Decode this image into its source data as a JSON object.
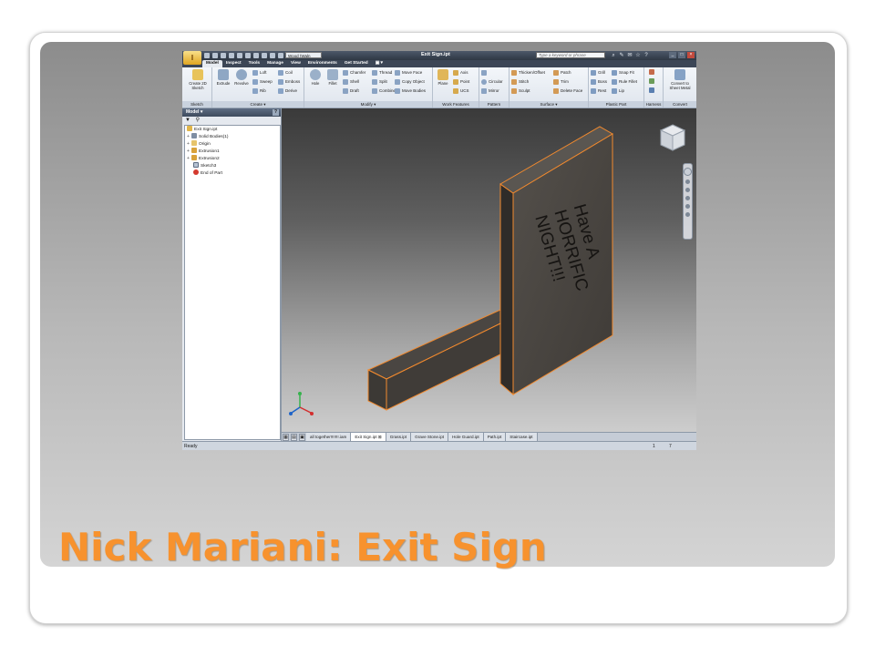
{
  "slide": {
    "title": "Nick Mariani: Exit Sign"
  },
  "app": {
    "window_title": "Exit Sign.ipt",
    "material": "Wood (Waln",
    "search_placeholder": "Type a keyword or phrase",
    "tabs": [
      "Model",
      "Inspect",
      "Tools",
      "Manage",
      "View",
      "Environments",
      "Get Started"
    ],
    "ribbon": {
      "sketch": {
        "label": "Sketch",
        "create_2d": "Create 2D Sketch"
      },
      "create": {
        "label": "Create",
        "extrude": "Extrude",
        "revolve": "Revolve",
        "loft": "Loft",
        "sweep": "Sweep",
        "rib": "Rib",
        "coil": "Coil",
        "emboss": "Emboss",
        "derive": "Derive"
      },
      "modify": {
        "label": "Modify",
        "hole": "Hole",
        "fillet": "Fillet",
        "chamfer": "Chamfer",
        "shell": "Shell",
        "draft": "Draft",
        "thread": "Thread",
        "split": "Split",
        "combine": "Combine",
        "move_face": "Move Face",
        "copy_object": "Copy Object",
        "move_bodies": "Move Bodies"
      },
      "work_features": {
        "label": "Work Features",
        "plane": "Plane",
        "axis": "Axis",
        "point": "Point",
        "ucs": "UCS"
      },
      "pattern": {
        "label": "Pattern",
        "circular": "Circular",
        "mirror": "Mirror"
      },
      "surface": {
        "label": "Surface",
        "thicken": "Thicken/Offset",
        "stitch": "Stitch",
        "sculpt": "Sculpt",
        "patch": "Patch",
        "trim": "Trim",
        "delete_face": "Delete Face"
      },
      "plastic_part": {
        "label": "Plastic Part",
        "grill": "Grill",
        "boss": "Boss",
        "rest": "Rest",
        "snap_fit": "Snap Fit",
        "rule_fillet": "Rule Fillet",
        "lip": "Lip"
      },
      "harness": {
        "label": "Harness"
      },
      "convert": {
        "label": "Convert",
        "sheet_metal": "Convert to Sheet Metal"
      }
    },
    "browser": {
      "header": "Model",
      "filter_icon": "filter-icon",
      "search_icon": "binoculars-icon",
      "tree": [
        "Exit Sign.ipt",
        "Solid Bodies(1)",
        "Origin",
        "Extrusion1",
        "Extrusion2",
        "Sketch3",
        "End of Part"
      ]
    },
    "sign_text": [
      "Have A",
      "HORRIFIC",
      "NIGHT!!!"
    ],
    "doc_tabs": [
      "all together!!!!!!!.iam",
      "Exit Sign.ipt",
      "Grass.ipt",
      "Grave Stone.ipt",
      "Hole Guard.ipt",
      "Path.ipt",
      "Staircase.ipt"
    ],
    "status": {
      "left": "Ready",
      "r1": "1",
      "r2": "7"
    }
  }
}
